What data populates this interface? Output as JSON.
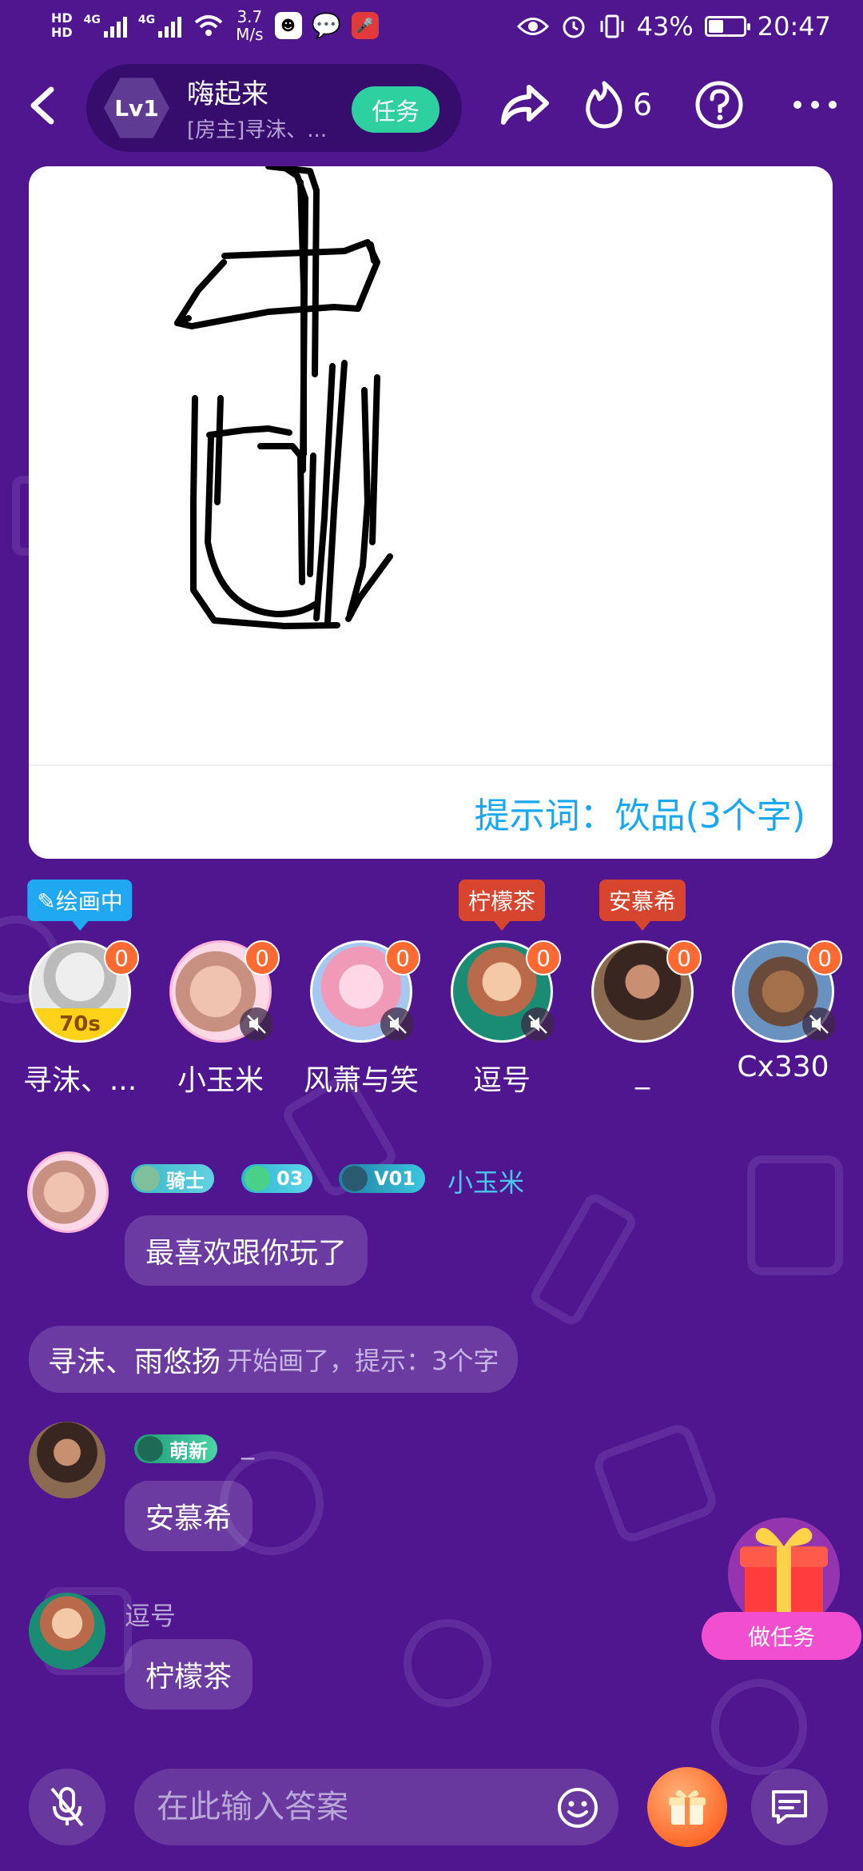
{
  "status_bar": {
    "hd1": "HD",
    "hd2": "HD",
    "net1": "4G",
    "net2": "4G",
    "speed_value": "3.7",
    "speed_unit": "M/s",
    "battery_percent": "43%",
    "battery_level": 0.43,
    "time": "20:47"
  },
  "header": {
    "level": "Lv1",
    "room_name": "嗨起来",
    "room_subtitle": "[房主]寻沫、...",
    "task_button": "任务",
    "fire_count": "6"
  },
  "canvas": {
    "hint": "提示词：饮品(3个字)"
  },
  "players": [
    {
      "name": "寻沫、...",
      "score": "0",
      "tag": "绘画中",
      "timer": "70s",
      "muted": false
    },
    {
      "name": "小玉米",
      "score": "0",
      "tag": "",
      "muted": true
    },
    {
      "name": "风萧与笑",
      "score": "0",
      "tag": "",
      "muted": true
    },
    {
      "name": "逗号",
      "score": "0",
      "tag": "柠檬茶",
      "muted": true
    },
    {
      "name": "_",
      "score": "0",
      "tag": "安慕希",
      "muted": false
    },
    {
      "name": "Cx330",
      "score": "0",
      "tag": "",
      "muted": true
    }
  ],
  "chat": {
    "msg1": {
      "badge_knight": "骑士",
      "badge_level": "03",
      "badge_vip": "V01",
      "username": "小玉米",
      "text": "最喜欢跟你玩了"
    },
    "system": {
      "who": "寻沫、雨悠扬",
      "text": "开始画了，提示：3个字"
    },
    "msg2": {
      "badge": "萌新",
      "username": "_",
      "text": "安慕希"
    },
    "msg3": {
      "username": "逗号",
      "text": "柠檬茶"
    }
  },
  "float_task": {
    "label": "做任务"
  },
  "bottom": {
    "placeholder": "在此输入答案"
  },
  "colors": {
    "background": "#4f168f",
    "hint": "#19a8f0",
    "task_green": "#2fd0a0",
    "score_orange": "#ff6a32",
    "username_cyan": "#49c8ee"
  }
}
